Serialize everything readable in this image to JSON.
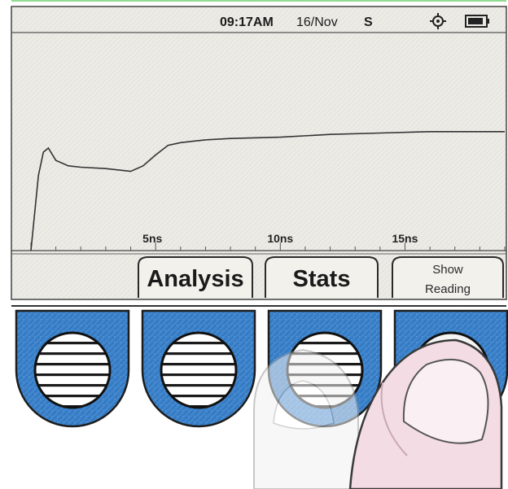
{
  "status_bar": {
    "time": "09:17AM",
    "date": "16/Nov",
    "mode": "S",
    "gps_icon": "crosshair-gps-icon",
    "battery_icon": "battery-icon"
  },
  "chart_data": {
    "type": "line",
    "x_ticks": [
      "5ns",
      "10ns",
      "15ns"
    ],
    "xlabel": "",
    "ylabel": "",
    "xlim": [
      0,
      19
    ],
    "ylim": [
      0,
      1
    ],
    "grid": false,
    "series": [
      {
        "x": [
          0,
          0.3,
          0.5,
          0.7,
          1.0,
          1.5,
          2.0,
          3.0,
          4.0,
          4.5,
          5.0,
          5.5,
          6.0,
          6.5,
          7.0,
          8.0,
          10.0,
          12.0,
          14.0,
          16.0,
          18.0,
          19.0
        ],
        "y": [
          0.0,
          0.55,
          0.72,
          0.75,
          0.66,
          0.62,
          0.61,
          0.6,
          0.58,
          0.62,
          0.7,
          0.77,
          0.79,
          0.8,
          0.81,
          0.82,
          0.83,
          0.85,
          0.86,
          0.87,
          0.87,
          0.87
        ]
      }
    ]
  },
  "softkeys": [
    {
      "label": "",
      "style": "blank"
    },
    {
      "label": "Analysis",
      "style": "large"
    },
    {
      "label": "Stats",
      "style": "large"
    },
    {
      "label_line1": "Show",
      "label_line2": "Reading",
      "style": "small"
    }
  ],
  "colors": {
    "lcd_bg": "#ecebe6",
    "button_blue": "#3f86cf",
    "trace": "#333333"
  },
  "hardware_buttons": [
    {
      "name": "hardware-button-1-icon"
    },
    {
      "name": "hardware-button-2-icon"
    },
    {
      "name": "hardware-button-3-icon"
    },
    {
      "name": "hardware-button-4-icon"
    }
  ]
}
